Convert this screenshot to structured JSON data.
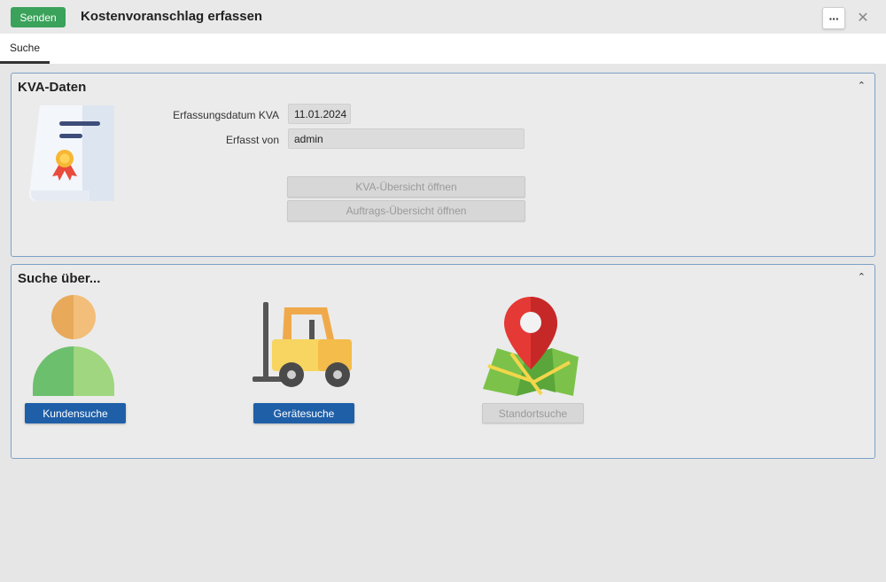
{
  "header": {
    "send_label": "Senden",
    "title": "Kostenvoranschlag erfassen",
    "more_label": "···",
    "close_label": "✕"
  },
  "tabs": [
    {
      "label": "Suche",
      "active": true
    }
  ],
  "kva_panel": {
    "title": "KVA-Daten",
    "collapse_glyph": "⌃",
    "date_label": "Erfassungsdatum KVA",
    "date_value": "11.01.2024",
    "user_label": "Erfasst von",
    "user_value": "admin",
    "btn_overview": "KVA-Übersicht öffnen",
    "btn_orders": "Auftrags-Übersicht öffnen"
  },
  "search_panel": {
    "title": "Suche über...",
    "collapse_glyph": "⌃",
    "btn_customer": "Kundensuche",
    "btn_device": "Gerätesuche",
    "btn_location": "Standortsuche"
  },
  "colors": {
    "send_green": "#3aa25a",
    "primary_blue": "#1f5fa8",
    "panel_border": "#7da1c7"
  },
  "icons": [
    "document-certificate-icon",
    "person-icon",
    "forklift-icon",
    "map-pin-icon"
  ]
}
